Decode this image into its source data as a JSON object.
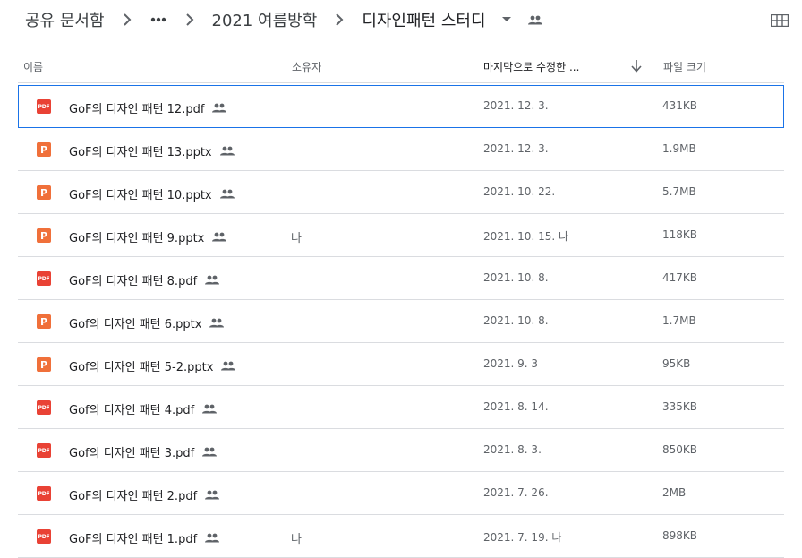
{
  "breadcrumb": {
    "root": "공유 문서함",
    "more_label": "•••",
    "parent": "2021 여름방학",
    "current": "디자인패턴 스터디"
  },
  "icons": {
    "chevron": "chevron-right-icon",
    "more": "more-horiz-icon",
    "dropdown": "arrow-drop-down-icon",
    "shared": "people-icon",
    "grid": "grid-view-icon",
    "sort": "arrow-downward-icon"
  },
  "columns": {
    "name": "이름",
    "owner": "소유자",
    "modified": "마지막으로 수정한 ...",
    "size": "파일 크기"
  },
  "colors": {
    "pdf": "#e94235",
    "pptx": "#f0703a",
    "selection": "#1a73e8"
  },
  "files": [
    {
      "type": "pdf",
      "type_label": "PDF",
      "name": "GoF의 디자인 패턴 12.pdf",
      "owner": "",
      "modified": "2021. 12. 3.",
      "size": "431KB",
      "selected": true
    },
    {
      "type": "pptx",
      "type_label": "P",
      "name": "GoF의 디자인 패턴 13.pptx",
      "owner": "",
      "modified": "2021. 12. 3.",
      "size": "1.9MB"
    },
    {
      "type": "pptx",
      "type_label": "P",
      "name": "GoF의 디자인 패턴 10.pptx",
      "owner": "",
      "modified": "2021. 10. 22.",
      "size": "5.7MB"
    },
    {
      "type": "pptx",
      "type_label": "P",
      "name": "GoF의 디자인 패턴 9.pptx",
      "owner": "나",
      "modified": "2021. 10. 15. 나",
      "size": "118KB"
    },
    {
      "type": "pdf",
      "type_label": "PDF",
      "name": "GoF의 디자인 패턴 8.pdf",
      "owner": "",
      "modified": "2021. 10. 8.",
      "size": "417KB"
    },
    {
      "type": "pptx",
      "type_label": "P",
      "name": "Gof의 디자인 패턴 6.pptx",
      "owner": "",
      "modified": "2021. 10. 8.",
      "size": "1.7MB"
    },
    {
      "type": "pptx",
      "type_label": "P",
      "name": "Gof의 디자인 패턴 5-2.pptx",
      "owner": "",
      "modified": "2021. 9. 3",
      "size": "95KB"
    },
    {
      "type": "pdf",
      "type_label": "PDF",
      "name": "Gof의 디자인 패턴 4.pdf",
      "owner": "",
      "modified": "2021. 8. 14.",
      "size": "335KB"
    },
    {
      "type": "pdf",
      "type_label": "PDF",
      "name": "Gof의 디자인 패턴 3.pdf",
      "owner": "",
      "modified": "2021. 8. 3.",
      "size": "850KB"
    },
    {
      "type": "pdf",
      "type_label": "PDF",
      "name": "GoF의 디자인 패턴 2.pdf",
      "owner": "",
      "modified": "2021. 7. 26.",
      "size": "2MB"
    },
    {
      "type": "pdf",
      "type_label": "PDF",
      "name": "GoF의 디자인 패턴 1.pdf",
      "owner": "나",
      "modified": "2021. 7. 19. 나",
      "size": "898KB"
    }
  ]
}
